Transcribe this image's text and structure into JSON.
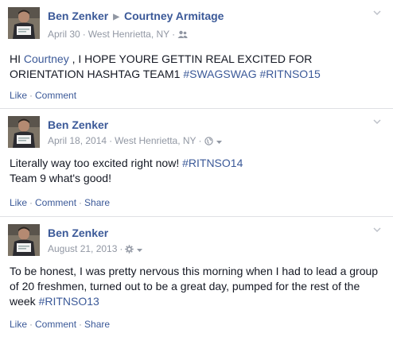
{
  "posts": [
    {
      "author": "Ben Zenker",
      "target": "Courtney Armitage",
      "date": "April 30",
      "location": "West Henrietta, NY",
      "privacy_icon": "friends-icon",
      "text_prefix": "HI ",
      "mention": "Courtney",
      "text_main": " , I HOPE YOURE GETTIN REAL EXCITED FOR ORIENTATION HASHTAG TEAM1 ",
      "hashtags": "#SWAGSWAG #RITNSO15",
      "actions": [
        "Like",
        "Comment"
      ]
    },
    {
      "author": "Ben Zenker",
      "date": "April 18, 2014",
      "location": "West Henrietta, NY",
      "privacy_icon": "globe-icon",
      "text_line1": "Literally way too excited right now! ",
      "hashtag": "#RITNSO14",
      "text_line2": "Team 9 what's good!",
      "actions": [
        "Like",
        "Comment",
        "Share"
      ]
    },
    {
      "author": "Ben Zenker",
      "date": "August 21, 2013",
      "privacy_icon": "gear-icon",
      "text_main": "To be honest, I was pretty nervous this morning when I had to lead a group of 20 freshmen, turned out to be a great day, pumped for the rest of the week ",
      "hashtag": "#RITNSO13",
      "actions": [
        "Like",
        "Comment",
        "Share"
      ]
    }
  ],
  "separators": {
    "dot": "·"
  },
  "colors": {
    "link": "#3b5998",
    "meta": "#9197a3",
    "text": "#141823",
    "divider": "#dfe0e4"
  }
}
